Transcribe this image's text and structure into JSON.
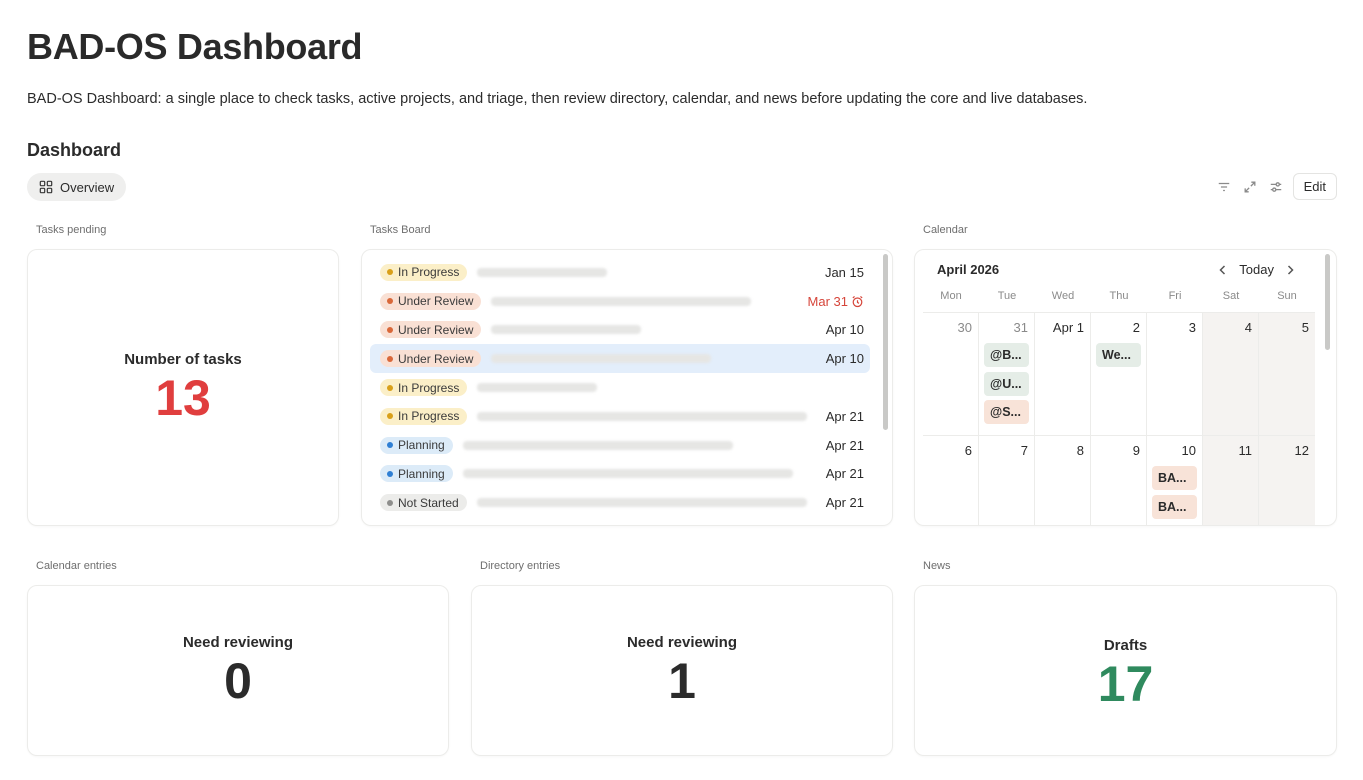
{
  "page": {
    "title": "BAD-OS Dashboard",
    "description": "BAD-OS Dashboard: a single place to check tasks, active projects, and triage, then review directory, calendar, and news before updating the core and live databases.",
    "section_title": "Dashboard"
  },
  "view_tab": {
    "label": "Overview",
    "icon": "layout-grid-icon"
  },
  "toolbar": {
    "edit_label": "Edit",
    "icons": [
      "filter-icon",
      "expand-icon",
      "settings-sliders-icon"
    ]
  },
  "tasks_pending": {
    "label": "Tasks pending",
    "title": "Number of tasks",
    "value": "13",
    "color": "#e03e3e"
  },
  "tasks_board": {
    "label": "Tasks Board",
    "rows": [
      {
        "status": "In Progress",
        "date": "Jan 15"
      },
      {
        "status": "Under Review",
        "date": "Mar 31",
        "overdue": true
      },
      {
        "status": "Under Review",
        "date": "Apr 10"
      },
      {
        "status": "Under Review",
        "date": "Apr 10",
        "selected": true
      },
      {
        "status": "In Progress",
        "date": ""
      },
      {
        "status": "In Progress",
        "date": "Apr 21"
      },
      {
        "status": "Planning",
        "date": "Apr 21"
      },
      {
        "status": "Planning",
        "date": "Apr 21"
      },
      {
        "status": "Not Started",
        "date": "Apr 21"
      }
    ],
    "status_colors": {
      "In Progress": {
        "bg": "#fbefc8",
        "dot": "#d9a01a"
      },
      "Under Review": {
        "bg": "#f9e0d4",
        "dot": "#d9683a"
      },
      "Planning": {
        "bg": "#dcebf8",
        "dot": "#2f7fd4"
      },
      "Not Started": {
        "bg": "#ececea",
        "dot": "#8e8e8c"
      }
    }
  },
  "calendar": {
    "label": "Calendar",
    "month": "April 2026",
    "today_label": "Today",
    "weekdays": [
      "Mon",
      "Tue",
      "Wed",
      "Thu",
      "Fri",
      "Sat",
      "Sun"
    ],
    "weeks": [
      [
        "30",
        "31",
        "Apr 1",
        "2",
        "3",
        "4",
        "5"
      ],
      [
        "6",
        "7",
        "8",
        "9",
        "10",
        "11",
        "12"
      ]
    ],
    "events": {
      "w0d1": [
        {
          "text": "@B...",
          "color": "green"
        },
        {
          "text": "@U...",
          "color": "green"
        },
        {
          "text": "@S...",
          "color": "peach"
        }
      ],
      "w0d3": [
        {
          "text": "We...",
          "color": "green"
        }
      ],
      "w1d4": [
        {
          "text": "BA...",
          "color": "peach"
        },
        {
          "text": "BA...",
          "color": "peach"
        }
      ]
    }
  },
  "calendar_entries": {
    "label": "Calendar entries",
    "title": "Need reviewing",
    "value": "0",
    "color": "#2b2b2b"
  },
  "directory_entries": {
    "label": "Directory entries",
    "title": "Need reviewing",
    "value": "1",
    "color": "#2b2b2b"
  },
  "news": {
    "label": "News",
    "title": "Drafts",
    "value": "17",
    "color": "#2f8a5e"
  }
}
